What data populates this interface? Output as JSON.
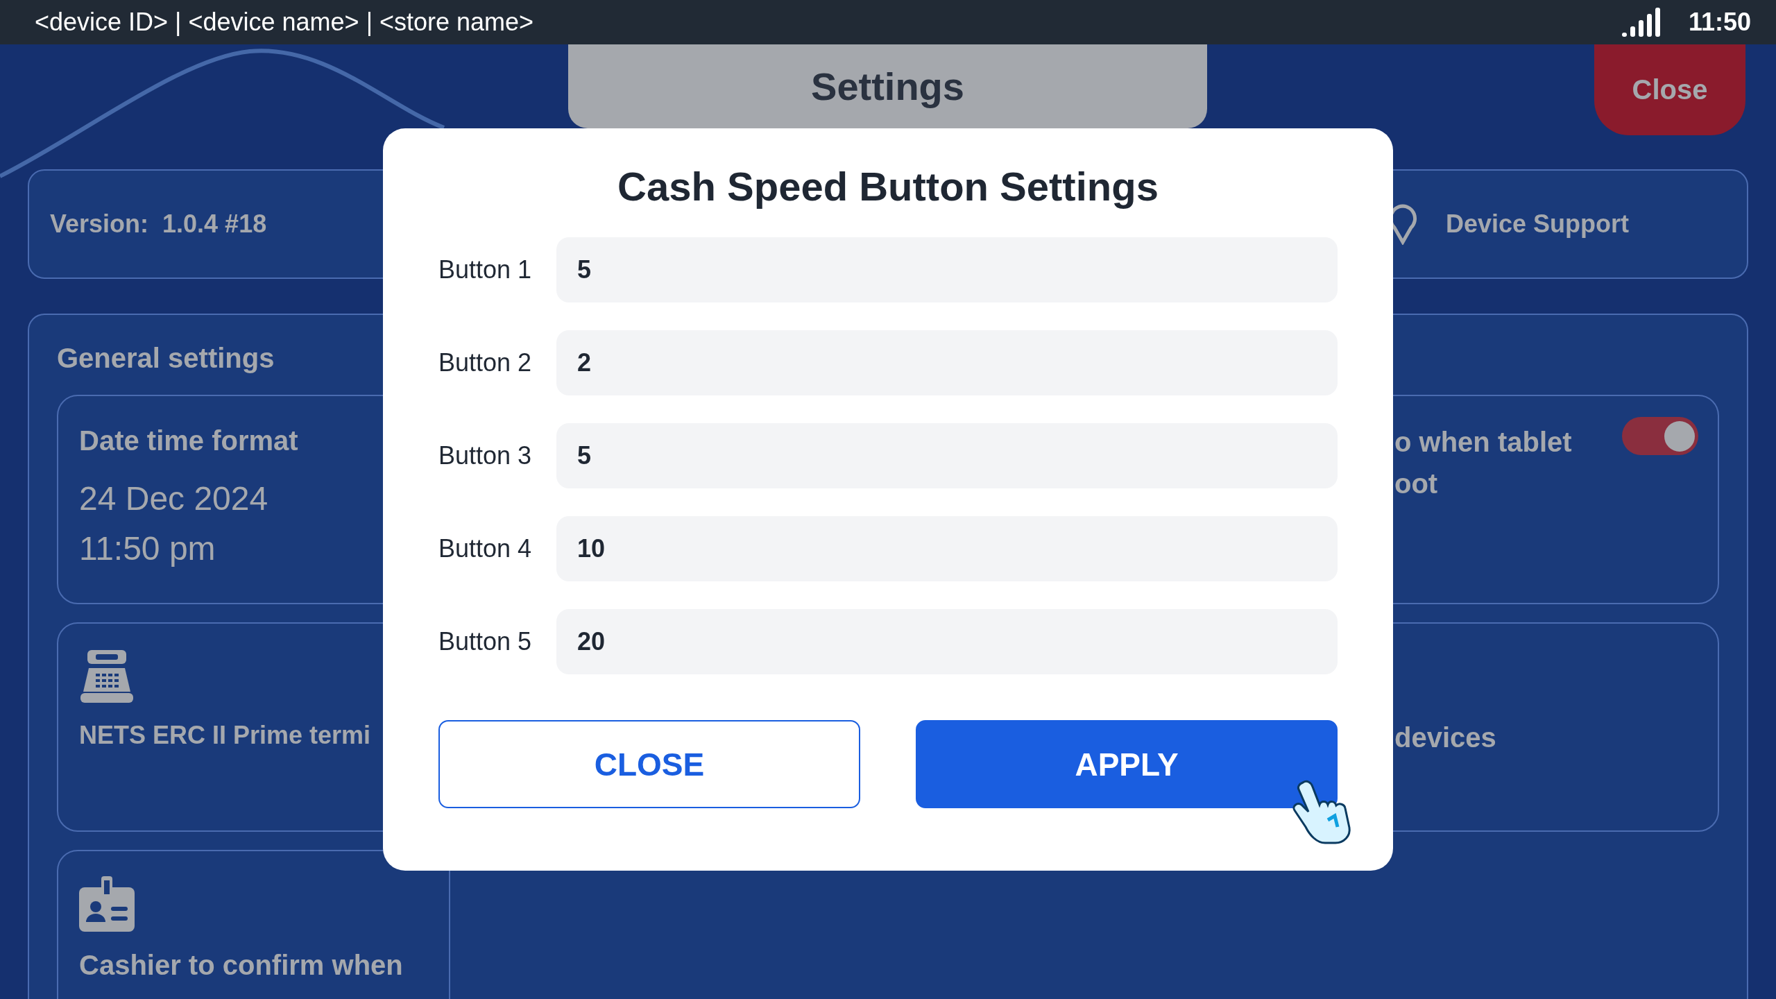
{
  "status_bar": {
    "title": "<device ID> | <device name> | <store name>",
    "time": "11:50"
  },
  "header": {
    "title": "Settings",
    "close_button": "Close"
  },
  "info_bar": {
    "version": "Version:  1.0.4 #18",
    "support": "Device Support"
  },
  "general_settings": {
    "title": "General settings",
    "cards": [
      {
        "kind": "datetime",
        "title": "Date time format",
        "date": "24 Dec 2024",
        "time": "11:50 pm"
      },
      {
        "kind": "terminal",
        "title": "NETS ERC II Prime termi"
      },
      {
        "kind": "cashier",
        "title": "Cashier to confirm when"
      },
      {
        "kind": "toggle",
        "lines": [
          "o when tablet",
          "oot"
        ],
        "on": true
      },
      {
        "kind": "devices",
        "title": "devices"
      }
    ]
  },
  "dialog": {
    "title": "Cash Speed Button Settings",
    "fields": [
      {
        "label": "Button 1",
        "value": "5"
      },
      {
        "label": "Button 2",
        "value": "2"
      },
      {
        "label": "Button 3",
        "value": "5"
      },
      {
        "label": "Button 4",
        "value": "10"
      },
      {
        "label": "Button 5",
        "value": "20"
      }
    ],
    "buttons": [
      {
        "kind": "secondary",
        "label": "CLOSE"
      },
      {
        "kind": "primary",
        "label": "APPLY"
      }
    ]
  }
}
